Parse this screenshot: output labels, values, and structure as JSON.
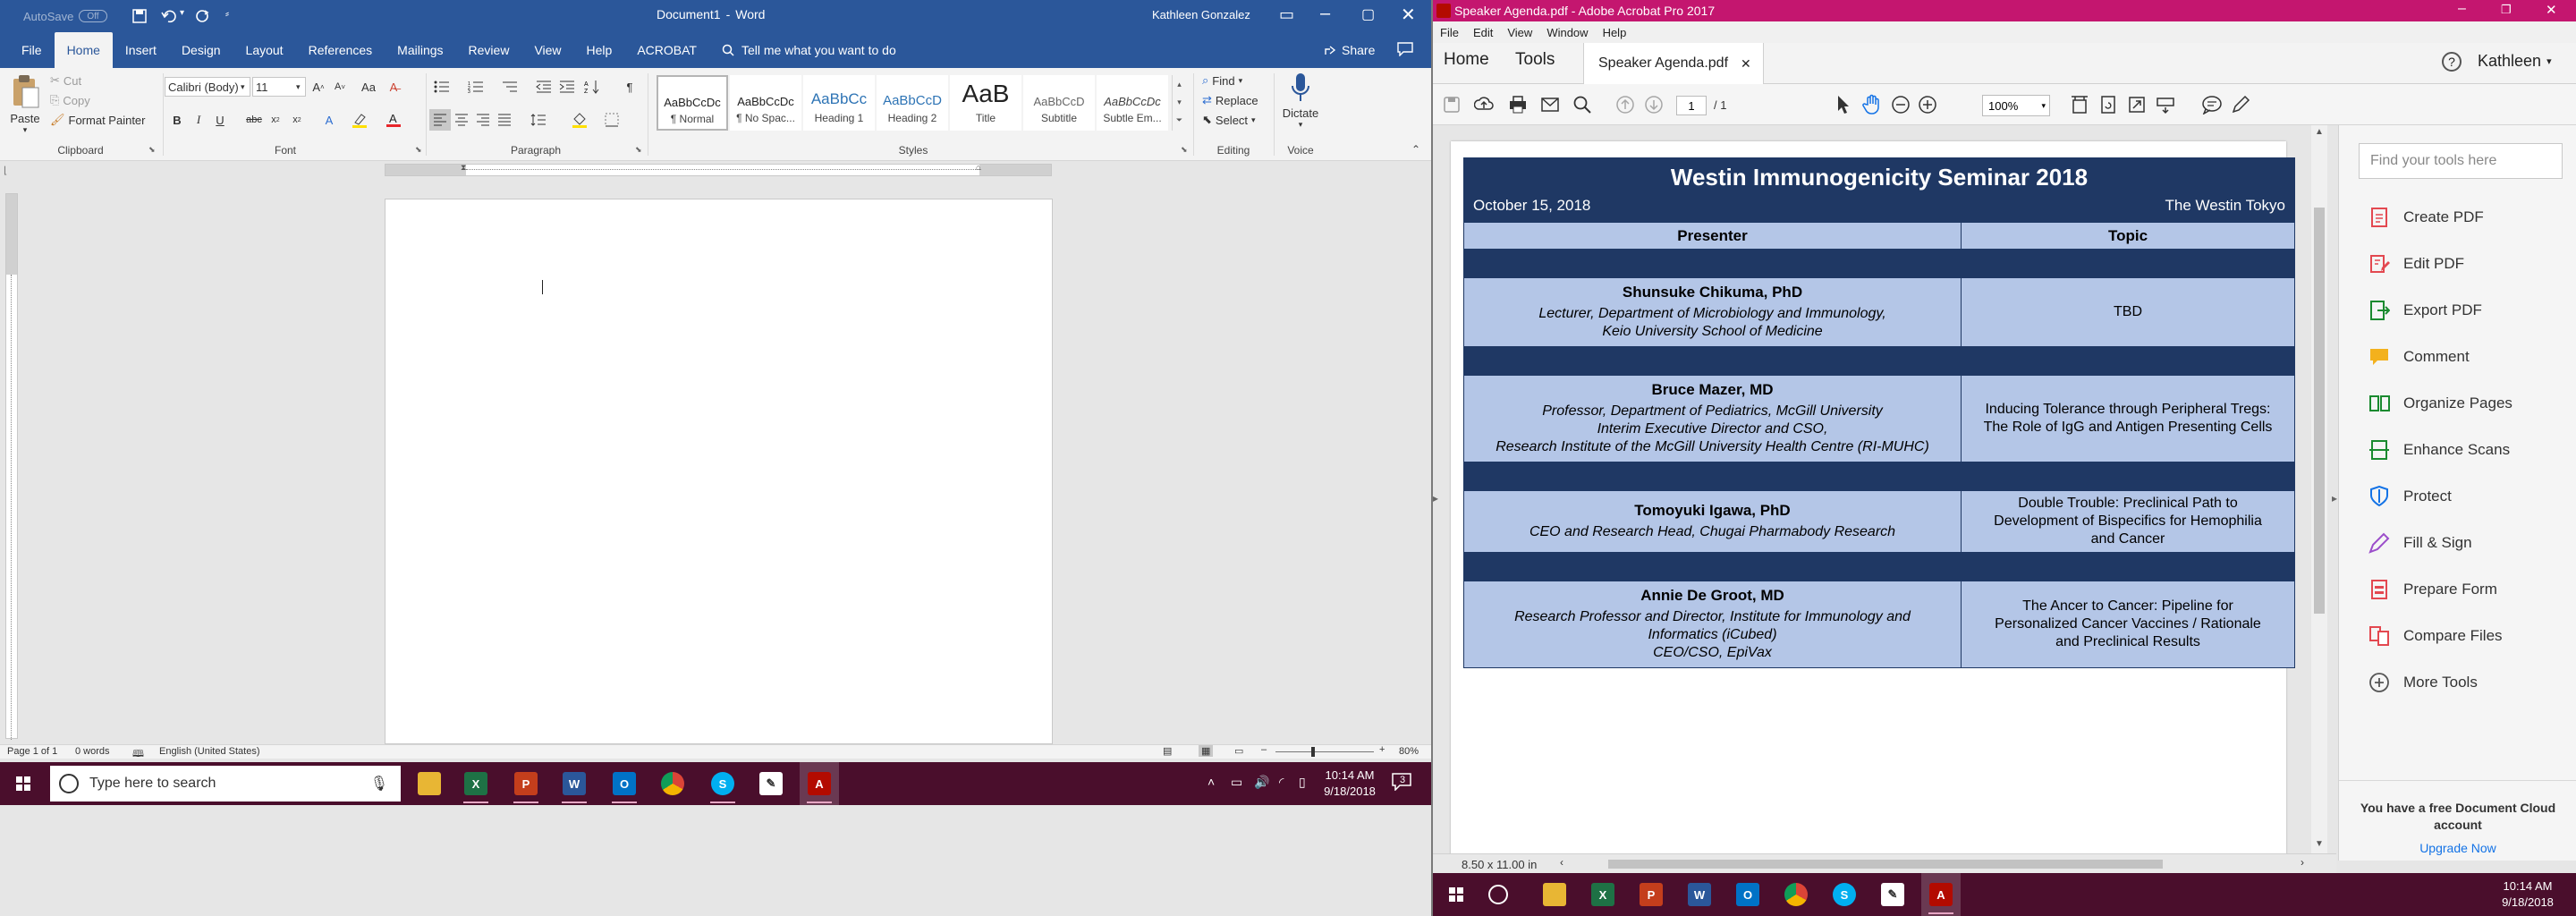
{
  "word": {
    "autosave_label": "AutoSave",
    "autosave_state": "Off",
    "doc_title": "Document1",
    "app_name": "Word",
    "user": "Kathleen Gonzalez",
    "tabs": [
      "File",
      "Home",
      "Insert",
      "Design",
      "Layout",
      "References",
      "Mailings",
      "Review",
      "View",
      "Help",
      "ACROBAT"
    ],
    "active_tab": "Home",
    "tell_me": "Tell me what you want to do",
    "share": "Share",
    "clipboard": {
      "paste": "Paste",
      "cut": "Cut",
      "copy": "Copy",
      "format_painter": "Format Painter",
      "label": "Clipboard"
    },
    "font": {
      "name": "Calibri (Body)",
      "size": "11",
      "label": "Font"
    },
    "paragraph_label": "Paragraph",
    "styles": {
      "items": [
        {
          "preview": "AaBbCcDc",
          "name": "¶ Normal"
        },
        {
          "preview": "AaBbCcDc",
          "name": "¶ No Spac..."
        },
        {
          "preview": "AaBbCc",
          "name": "Heading 1"
        },
        {
          "preview": "AaBbCcD",
          "name": "Heading 2"
        },
        {
          "preview": "AaB",
          "name": "Title"
        },
        {
          "preview": "AaBbCcD",
          "name": "Subtitle"
        },
        {
          "preview": "AaBbCcDc",
          "name": "Subtle Em..."
        }
      ],
      "label": "Styles"
    },
    "editing": {
      "find": "Find",
      "replace": "Replace",
      "select": "Select",
      "label": "Editing"
    },
    "voice": {
      "dictate": "Dictate",
      "label": "Voice"
    },
    "status": {
      "page": "Page 1 of 1",
      "words": "0 words",
      "language": "English (United States)",
      "zoom": "80%"
    }
  },
  "acrobat": {
    "window_title": "Speaker Agenda.pdf - Adobe Acrobat Pro 2017",
    "menu": [
      "File",
      "Edit",
      "View",
      "Window",
      "Help"
    ],
    "home_tab": "Home",
    "tools_tab": "Tools",
    "doc_tab": "Speaker Agenda.pdf",
    "user": "Kathleen",
    "page_current": "1",
    "page_total": "/ 1",
    "zoom": "100%",
    "page_size": "8.50 x 11.00 in",
    "search_placeholder": "Find your tools here",
    "tools": [
      "Create PDF",
      "Edit PDF",
      "Export PDF",
      "Comment",
      "Organize Pages",
      "Enhance Scans",
      "Protect",
      "Fill & Sign",
      "Prepare Form",
      "Compare Files",
      "More Tools"
    ],
    "cloud_msg": "You have a free Document Cloud account",
    "upgrade": "Upgrade Now",
    "agenda": {
      "title": "Westin Immunogenicity Seminar 2018",
      "date": "October 15, 2018",
      "venue": "The Westin Tokyo",
      "col_presenter": "Presenter",
      "col_topic": "Topic",
      "rows": [
        {
          "name": "Shunsuke Chikuma, PhD",
          "desc": [
            "Lecturer, Department of Microbiology and Immunology,",
            "Keio University School of Medicine"
          ],
          "topic": [
            "TBD"
          ]
        },
        {
          "name": "Bruce Mazer, MD",
          "desc": [
            "Professor, Department of Pediatrics, McGill University",
            "Interim Executive Director and CSO,",
            "Research Institute of the McGill University Health Centre (RI-MUHC)"
          ],
          "topic": [
            "Inducing Tolerance through Peripheral Tregs:",
            "The Role of IgG and Antigen Presenting Cells"
          ]
        },
        {
          "name": "Tomoyuki Igawa, PhD",
          "desc": [
            "CEO and Research Head, Chugai Pharmabody Research"
          ],
          "topic": [
            "Double Trouble: Preclinical Path to",
            "Development of Bispecifics for Hemophilia",
            "and Cancer"
          ]
        },
        {
          "name": "Annie De Groot, MD",
          "desc": [
            "Research Professor and Director, Institute for Immunology and",
            "Informatics (iCubed)",
            "CEO/CSO, EpiVax"
          ],
          "topic": [
            "The Ancer to Cancer: Pipeline for",
            "Personalized Cancer Vaccines / Rationale",
            "and Preclinical Results"
          ]
        }
      ]
    }
  },
  "taskbar": {
    "search_placeholder": "Type here to search",
    "time": "10:14 AM",
    "date": "9/18/2018",
    "notif_count": "3"
  },
  "colors": {
    "word_blue": "#2b579a",
    "acrobat_red": "#c4166f",
    "taskbar": "#4a0e2c",
    "table_dark": "#1f3864",
    "table_light": "#b4c6e7"
  }
}
